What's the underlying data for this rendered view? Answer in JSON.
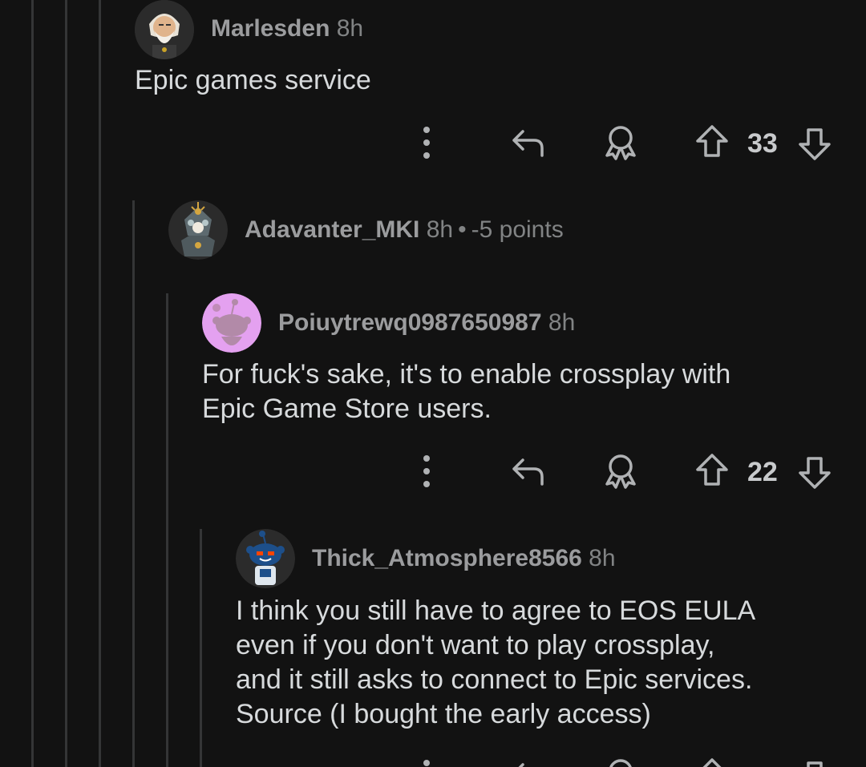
{
  "colors": {
    "background": "#121212",
    "thread_line": "#343536",
    "text": "#d7dadc",
    "meta": "#818384"
  },
  "comments": [
    {
      "username": "Marlesden",
      "age": "8h",
      "body": [
        "Epic games service"
      ],
      "score": "33",
      "avatar_icon": "bearded-elder-avatar"
    },
    {
      "username": "Adavanter_MKI",
      "age": "8h",
      "points": "-5 points",
      "avatar_icon": "armored-knight-avatar"
    },
    {
      "username": "Poiuytrewq0987650987",
      "age": "8h",
      "body": [
        "For fuck's sake, it's to enable crossplay with",
        "Epic Game Store users."
      ],
      "score": "22",
      "avatar_icon": "snoo-purple-avatar"
    },
    {
      "username": "Thick_Atmosphere8566",
      "age": "8h",
      "body": [
        "I think you still have to agree to EOS EULA",
        "even if you don't want to play crossplay,",
        "and it still asks to connect to Epic services.",
        "Source (I bought the early access)"
      ],
      "avatar_icon": "snoo-robot-avatar"
    }
  ],
  "actions": {
    "more_icon": "more-vertical-icon",
    "reply_icon": "reply-icon",
    "award_icon": "award-icon",
    "upvote_icon": "upvote-arrow-icon",
    "downvote_icon": "downvote-arrow-icon"
  }
}
